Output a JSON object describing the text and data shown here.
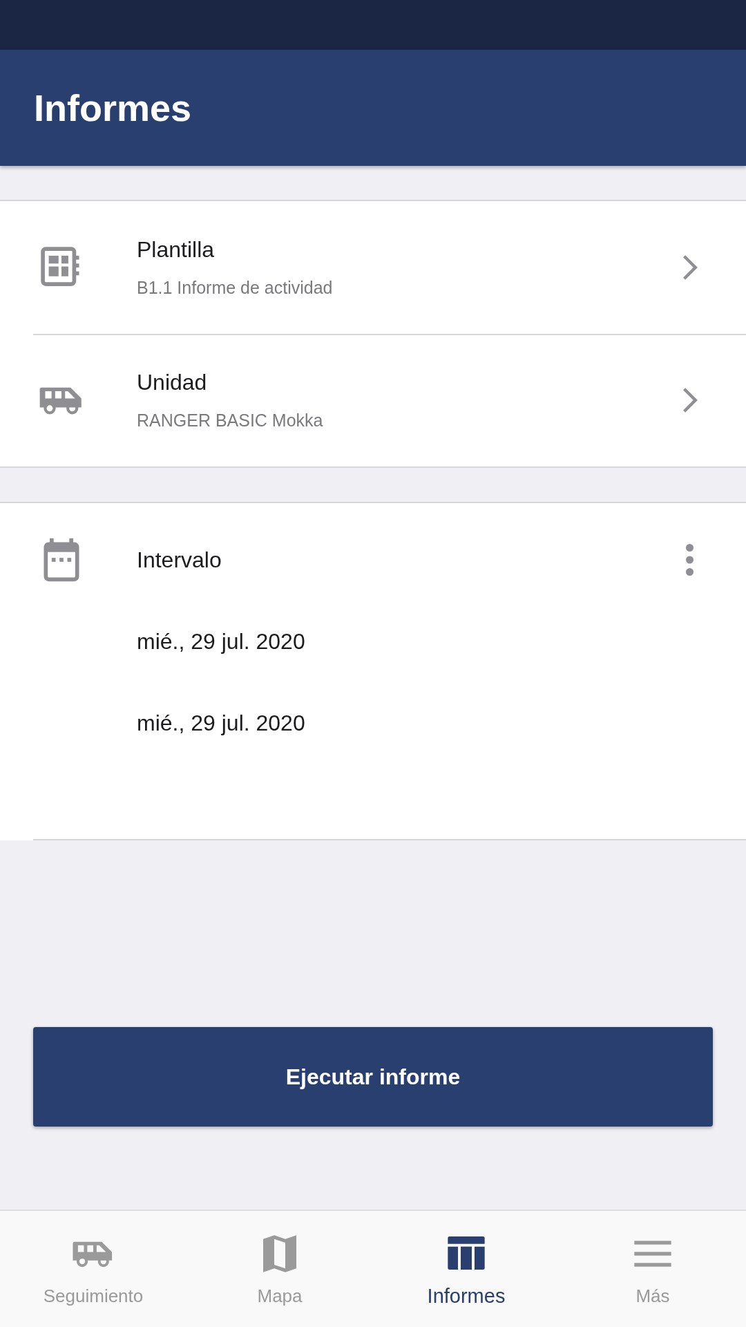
{
  "app_bar": {
    "title": "Informes"
  },
  "settings": [
    {
      "title": "Plantilla",
      "value": "B1.1 Informe de actividad"
    },
    {
      "title": "Unidad",
      "value": "RANGER BASIC Mokka"
    }
  ],
  "interval": {
    "title": "Intervalo",
    "dates": [
      "mié., 29 jul. 2020",
      "mié., 29 jul. 2020"
    ]
  },
  "run_button": {
    "label": "Ejecutar informe"
  },
  "bottom_nav": [
    {
      "label": "Seguimiento",
      "selected": false
    },
    {
      "label": "Mapa",
      "selected": false
    },
    {
      "label": "Informes",
      "selected": true
    },
    {
      "label": "Más",
      "selected": false
    }
  ]
}
